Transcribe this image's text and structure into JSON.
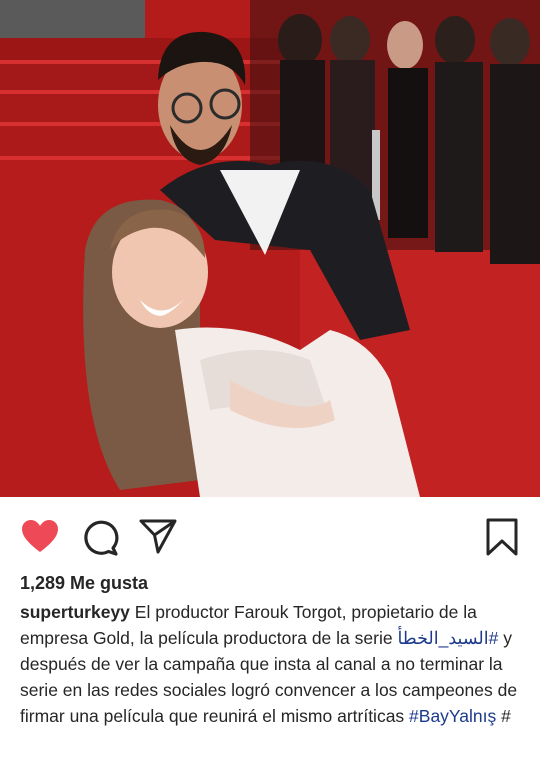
{
  "post": {
    "likes_text": "1,289 Me gusta",
    "username": "superturkeyy",
    "caption_part1": " El productor Farouk Torgot, propietario de la empresa Gold, la película productora de la serie ",
    "hashtag_arabic": "#السيد_الخطأ",
    "caption_part2": " y después de ver la campaña que insta al canal a no terminar la serie en las redes sociales logró convencer a los campeones de firmar una película que reunirá el mismo artríticas ",
    "hashtag_bay": "#BayYalnış",
    "hashtag_tail": " #"
  },
  "icons": {
    "like": "heart-icon",
    "comment": "comment-bubble-icon",
    "share": "paper-plane-icon",
    "save": "bookmark-icon"
  },
  "colors": {
    "heart": "#ed4956",
    "hashtag": "#1c3a8c",
    "text": "#262626"
  }
}
